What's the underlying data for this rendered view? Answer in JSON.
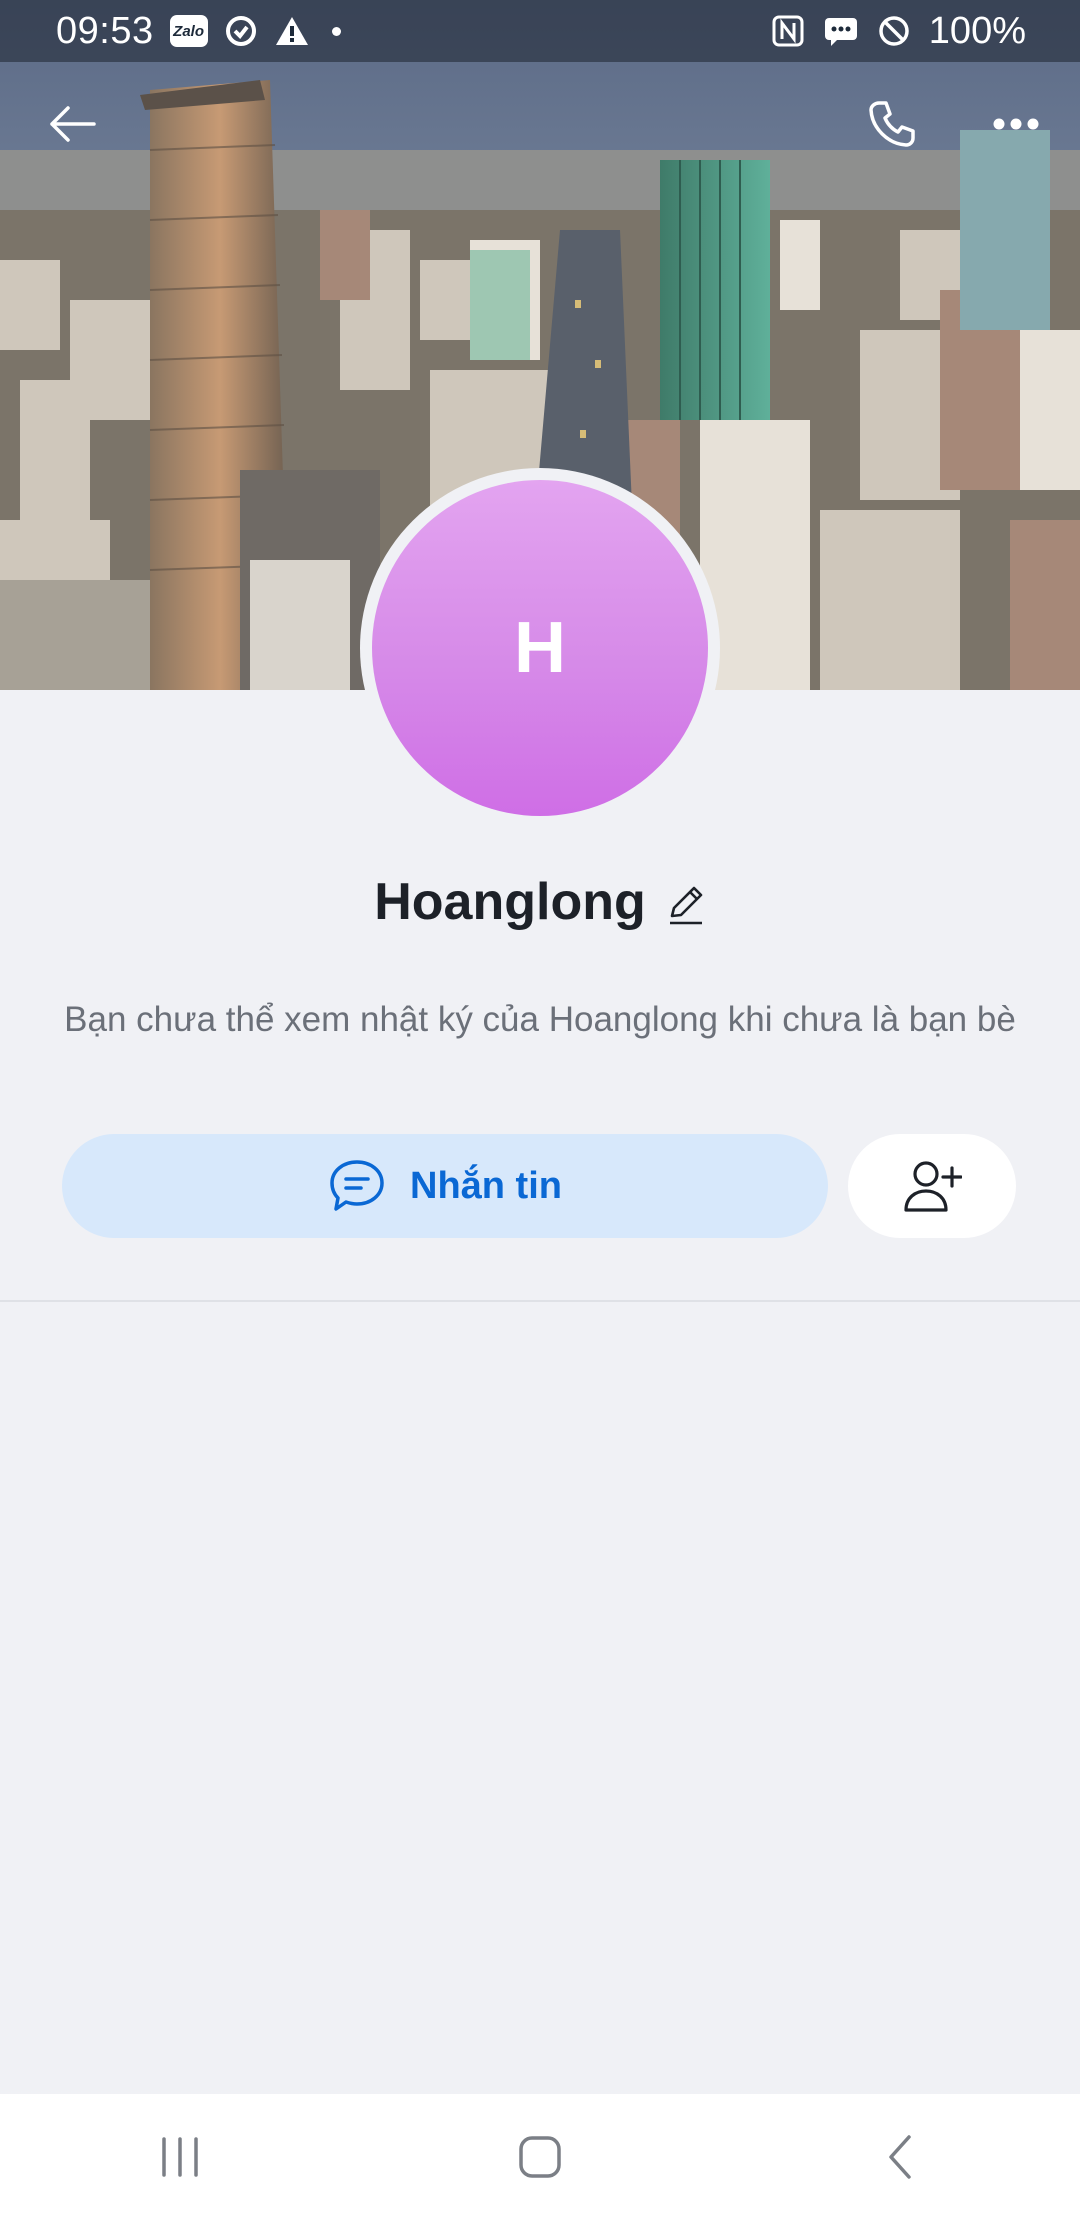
{
  "status_bar": {
    "time": "09:53",
    "battery": "100%",
    "left_icons": [
      "zalo-icon",
      "sync-icon",
      "warning-icon",
      "dot-icon"
    ],
    "right_icons": [
      "nfc-icon",
      "message-icon",
      "do-not-disturb-icon"
    ],
    "zalo_label": "Zalo"
  },
  "header": {
    "back_icon": "arrow-left-icon",
    "call_icon": "phone-icon",
    "more_icon": "more-horizontal-icon"
  },
  "profile": {
    "avatar_initial": "H",
    "name": "Hoanglong",
    "edit_icon": "pencil-icon",
    "info_text": "Bạn chưa thể xem nhật ký của Hoanglong khi chưa là bạn bè"
  },
  "actions": {
    "message_label": "Nhắn tin",
    "message_icon": "chat-bubble-icon",
    "add_friend_icon": "add-user-icon"
  },
  "colors": {
    "accent": "#0a68d4",
    "message_button_bg": "#d7e8fb",
    "avatar_top": "#e3a4f0",
    "avatar_bottom": "#cf6ee6",
    "page_bg": "#f0f1f5"
  },
  "nav_bar": {
    "recents_icon": "recent-apps-icon",
    "home_icon": "home-icon",
    "back_icon": "nav-back-icon"
  }
}
